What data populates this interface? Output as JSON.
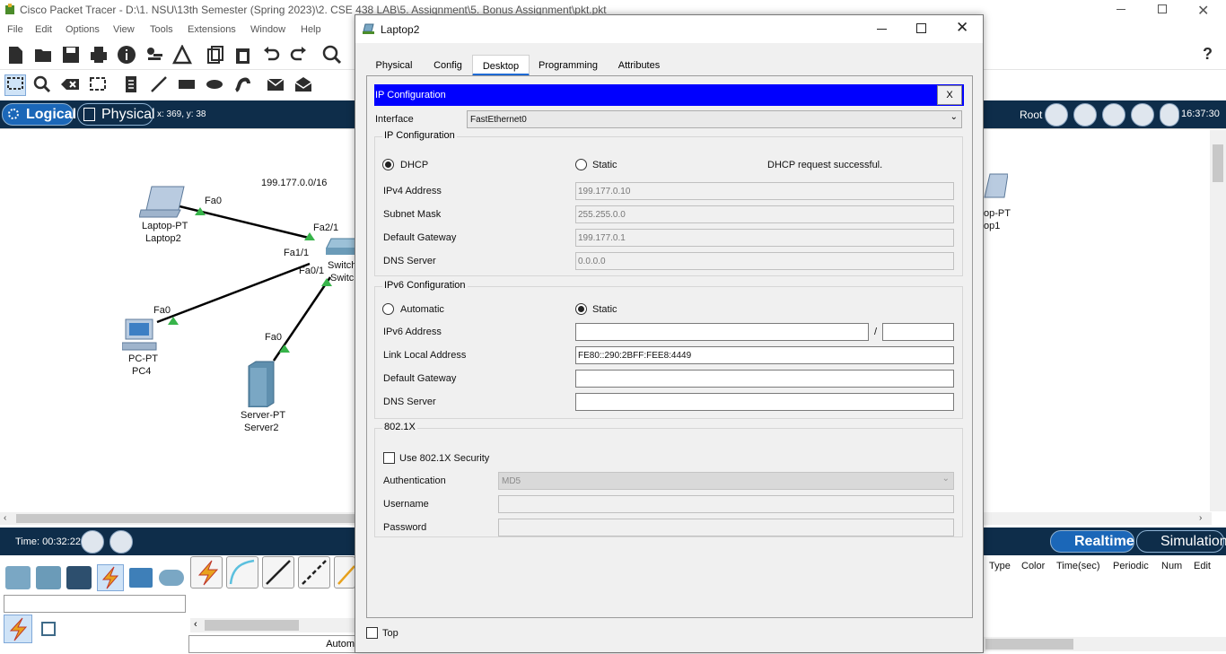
{
  "app": {
    "title": "Cisco Packet Tracer - D:\\1. NSU\\13th Semester (Spring 2023)\\2. CSE 438 LAB\\5. Assignment\\5. Bonus Assignment\\pkt.pkt",
    "menu": [
      "File",
      "Edit",
      "Options",
      "View",
      "Tools",
      "Extensions",
      "Window",
      "Help"
    ],
    "help_label": "?"
  },
  "nav": {
    "logical_label": "Logical",
    "physical_label": "Physical",
    "coords": "x: 369, y: 38",
    "root_label": "Root",
    "clock": "16:37:30"
  },
  "topology": {
    "network_label": "199.177.0.0/16",
    "devices": [
      {
        "type": "Laptop-PT",
        "name": "Laptop2"
      },
      {
        "type": "PC-PT",
        "name": "PC4"
      },
      {
        "type": "Server-PT",
        "name": "Server2"
      },
      {
        "type": "Switch",
        "name": "Switch"
      },
      {
        "type": "op-PT",
        "name": "op1"
      }
    ],
    "ports": {
      "laptop_fa0": "Fa0",
      "switch_fa21": "Fa2/1",
      "switch_fa11": "Fa1/1",
      "switch_fa01": "Fa0/1",
      "pc_fa0": "Fa0",
      "server_fa0": "Fa0"
    }
  },
  "bottom": {
    "time_label": "Time: 00:32:22",
    "realtime_label": "Realtime",
    "simulation_label": "Simulation",
    "event_columns": [
      "Type",
      "Color",
      "Time(sec)",
      "Periodic",
      "Num",
      "Edit"
    ],
    "auto_label": "Autom"
  },
  "dialog": {
    "title": "Laptop2",
    "tabs": [
      "Physical",
      "Config",
      "Desktop",
      "Programming",
      "Attributes"
    ],
    "active_tab": "Desktop",
    "header": "IP Configuration",
    "close_label": "X",
    "interface_label": "Interface",
    "interface_value": "FastEthernet0",
    "ipv4": {
      "group_title": "IP Configuration",
      "dhcp_label": "DHCP",
      "static_label": "Static",
      "selected": "DHCP",
      "status": "DHCP request successful.",
      "fields": [
        {
          "label": "IPv4 Address",
          "value": "199.177.0.10"
        },
        {
          "label": "Subnet Mask",
          "value": "255.255.0.0"
        },
        {
          "label": "Default Gateway",
          "value": "199.177.0.1"
        },
        {
          "label": "DNS Server",
          "value": "0.0.0.0"
        }
      ]
    },
    "ipv6": {
      "group_title": "IPv6 Configuration",
      "automatic_label": "Automatic",
      "static_label": "Static",
      "selected": "Static",
      "address_label": "IPv6 Address",
      "address_value": "",
      "prefix_sep": "/",
      "prefix_value": "",
      "link_local_label": "Link Local Address",
      "link_local_value": "FE80::290:2BFF:FEE8:4449",
      "gateway_label": "Default Gateway",
      "gateway_value": "",
      "dns_label": "DNS Server",
      "dns_value": ""
    },
    "dot1x": {
      "group_title": "802.1X",
      "use_label": "Use 802.1X Security",
      "auth_label": "Authentication",
      "auth_value": "MD5",
      "username_label": "Username",
      "password_label": "Password"
    },
    "top_label": "Top"
  }
}
